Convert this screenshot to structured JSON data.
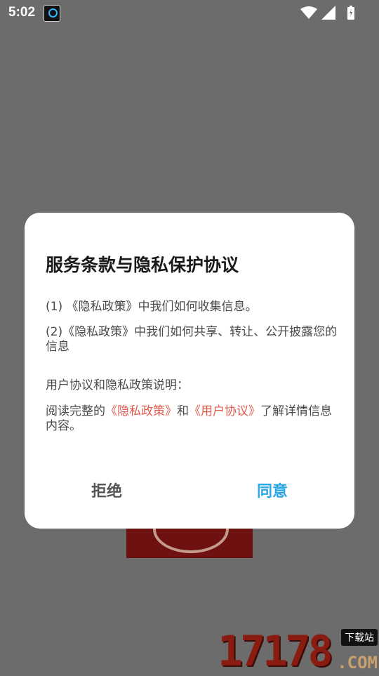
{
  "statusbar": {
    "time": "5:02",
    "app_icon": "app-notification-icon",
    "icons": [
      "wifi-icon",
      "signal-icon",
      "battery-icon"
    ]
  },
  "watermark": {
    "number": "17178",
    "tag": "下载站",
    "suffix": ".COM"
  },
  "dialog": {
    "title": "服务条款与隐私保护协议",
    "line1": "(1) 《隐私政策》中我们如何收集信息。",
    "line2": "(2)《隐私政策》中我们如何共享、转让、公开披露您的信息",
    "line3": "用户协议和隐私政策说明：",
    "line4_prefix": "阅读完整的",
    "line4_link1": "《隐私政策》",
    "line4_mid": "和",
    "line4_link2": "《用户协议》",
    "line4_suffix": "了解详情信息内容。",
    "reject_label": "拒绝",
    "agree_label": "同意"
  },
  "colors": {
    "link": "#e25a4e",
    "agree": "#2aa7e8",
    "overlay": "#6c6c6c"
  }
}
